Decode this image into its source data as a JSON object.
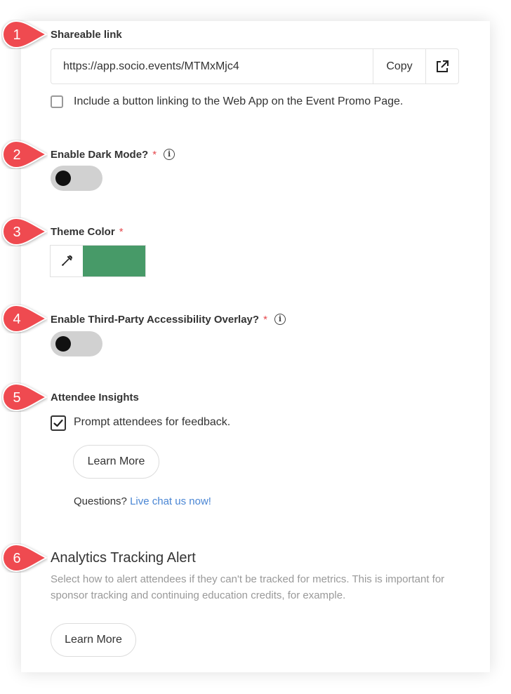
{
  "shareable_link": {
    "label": "Shareable link",
    "url": "https://app.socio.events/MTMxMjc4",
    "copy_label": "Copy",
    "checkbox_label": "Include a button linking to the Web App on the Event Promo Page.",
    "checkbox_checked": false
  },
  "dark_mode": {
    "label": "Enable Dark Mode?",
    "required_mark": "*",
    "enabled": false
  },
  "theme_color": {
    "label": "Theme Color",
    "required_mark": "*",
    "value": "#479a68"
  },
  "accessibility_overlay": {
    "label": "Enable Third-Party Accessibility Overlay?",
    "required_mark": "*",
    "enabled": false
  },
  "attendee_insights": {
    "label": "Attendee Insights",
    "checkbox_label": "Prompt attendees for feedback.",
    "checkbox_checked": true,
    "learn_more": "Learn More",
    "questions_text": "Questions?",
    "chat_link": "Live chat us now!"
  },
  "analytics_alert": {
    "title": "Analytics Tracking Alert",
    "description": "Select how to alert attendees if they can't be tracked for metrics. This is important for sponsor tracking and continuing education credits, for example.",
    "learn_more": "Learn More"
  },
  "markers": [
    "1",
    "2",
    "3",
    "4",
    "5",
    "6"
  ],
  "info_icon_glyph": "i",
  "colors": {
    "marker": "#ef4a50",
    "link": "#4a86d4",
    "required": "#e5484d",
    "toggle_track": "#d1d1d1"
  }
}
